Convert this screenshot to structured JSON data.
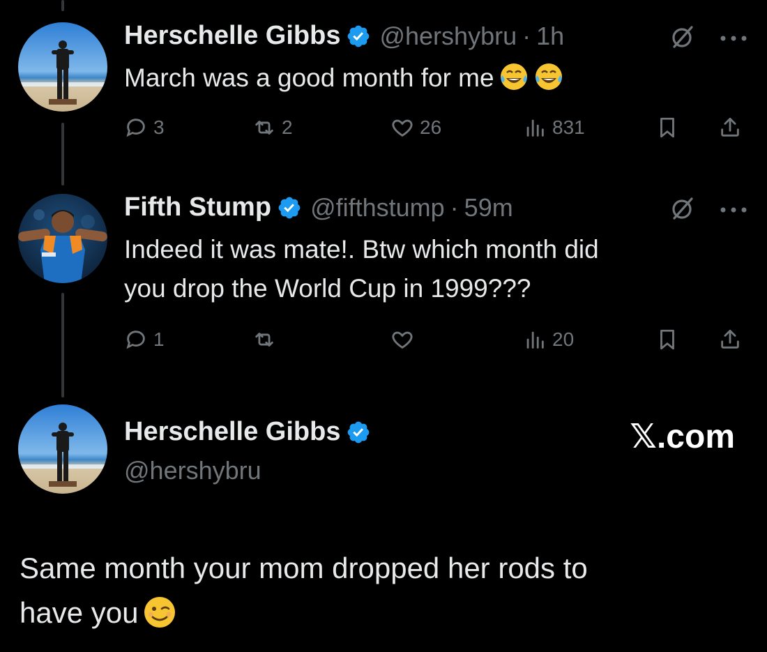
{
  "tweets": [
    {
      "name": "Herschelle Gibbs",
      "handle": "@hershybru",
      "separator": "·",
      "time": "1h",
      "text": "March was a good month for me",
      "emojis": [
        "tears-of-joy-emoji",
        "tears-of-joy-emoji"
      ],
      "replies": "3",
      "reposts": "2",
      "likes": "26",
      "views": "831"
    },
    {
      "name": "Fifth Stump",
      "handle": "@fifthstump",
      "separator": "·",
      "time": "59m",
      "text_line1": "Indeed it was mate!. Btw which month did",
      "text_line2": "you drop the World Cup in 1999???",
      "replies": "1",
      "reposts": "",
      "likes": "",
      "views": "20"
    }
  ],
  "main_reply": {
    "name": "Herschelle Gibbs",
    "handle": "@hershybru",
    "text_line1": "Same month your mom dropped her rods to",
    "text_line2": "have you",
    "emoji": "winking-face-emoji"
  },
  "watermark": "𝕏.com",
  "colors": {
    "background": "#000000",
    "text": "#e7e9ea",
    "secondary": "#71767b",
    "verified": "#1d9bf0",
    "thread_line": "#333639"
  }
}
